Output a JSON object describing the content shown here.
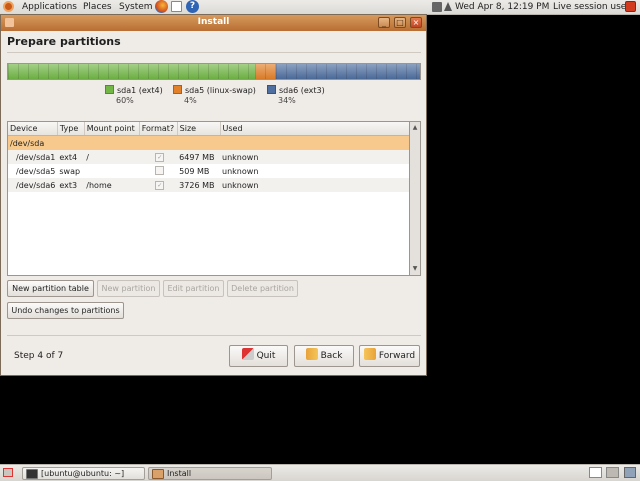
{
  "top_panel": {
    "menus": [
      "Applications",
      "Places",
      "System"
    ],
    "clock": "Wed Apr  8, 12:19 PM",
    "user": "Live session user"
  },
  "window": {
    "title": "Install",
    "heading": "Prepare partitions",
    "partition_bar": [
      {
        "label": "sda1 (ext4)",
        "percent": "60%",
        "fraction": 0.6,
        "color": "#72b746"
      },
      {
        "label": "sda5 (linux-swap)",
        "percent": "4%",
        "fraction": 0.05,
        "color": "#e3812a"
      },
      {
        "label": "sda6 (ext3)",
        "percent": "34%",
        "fraction": 0.35,
        "color": "#4f6fa0"
      }
    ],
    "table": {
      "headers": [
        "Device",
        "Type",
        "Mount point",
        "Format?",
        "Size",
        "Used"
      ],
      "disk": "/dev/sda",
      "rows": [
        {
          "device": "/dev/sda1",
          "type": "ext4",
          "mount": "/",
          "format": true,
          "size": "6497 MB",
          "used": "unknown"
        },
        {
          "device": "/dev/sda5",
          "type": "swap",
          "mount": "",
          "format": false,
          "size": "509 MB",
          "used": "unknown"
        },
        {
          "device": "/dev/sda6",
          "type": "ext3",
          "mount": "/home",
          "format": true,
          "size": "3726 MB",
          "used": "unknown"
        }
      ]
    },
    "buttons": {
      "new_table": "New partition table",
      "new_partition": "New partition",
      "edit_partition": "Edit partition",
      "delete_partition": "Delete partition",
      "undo": "Undo changes to partitions",
      "quit": "Quit",
      "back": "Back",
      "forward": "Forward"
    },
    "step": "Step 4 of 7"
  },
  "bottom_panel": {
    "tasks": [
      "[ubuntu@ubuntu: ~]",
      "Install"
    ]
  },
  "colors": {
    "titlebar": "#c57d40",
    "selection": "#f7c98c",
    "accent": "#e07b24"
  }
}
